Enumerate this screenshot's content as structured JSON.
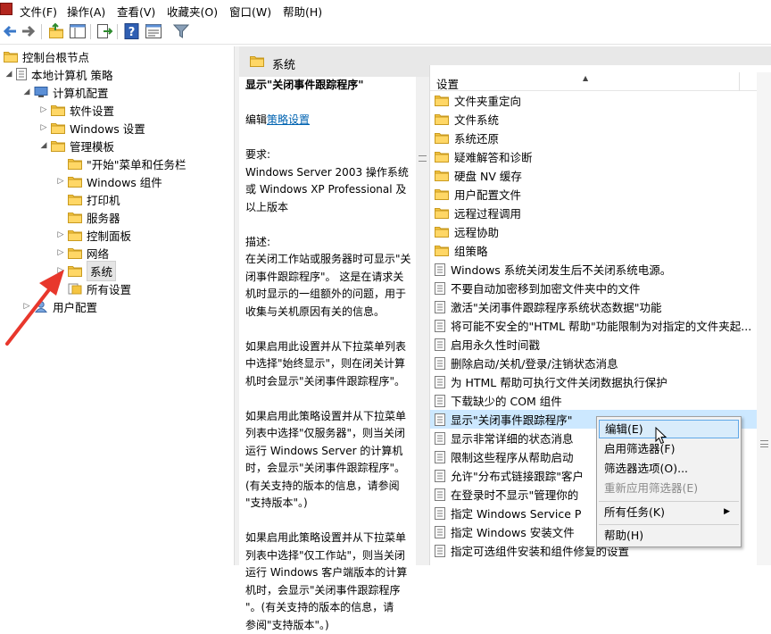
{
  "menubar": {
    "items": [
      "文件(F)",
      "操作(A)",
      "查看(V)",
      "收藏夹(O)",
      "窗口(W)",
      "帮助(H)"
    ]
  },
  "toolbar": {
    "icons": [
      "back-arrow-icon",
      "forward-arrow-icon",
      "up-folder-icon",
      "show-hide-tree-icon",
      "export-list-icon",
      "help-icon",
      "properties-icon",
      "filter-icon"
    ]
  },
  "tree": {
    "items": [
      {
        "label": "控制台根节点",
        "icon": "folder"
      },
      {
        "label": "本地计算机 策略",
        "icon": "policy"
      },
      {
        "label": "计算机配置",
        "icon": "computer"
      },
      {
        "label": "软件设置",
        "icon": "folder"
      },
      {
        "label": "Windows 设置",
        "icon": "folder"
      },
      {
        "label": "管理模板",
        "icon": "folder"
      },
      {
        "label": "\"开始\"菜单和任务栏",
        "icon": "folder"
      },
      {
        "label": "Windows 组件",
        "icon": "folder"
      },
      {
        "label": "打印机",
        "icon": "folder"
      },
      {
        "label": "服务器",
        "icon": "folder"
      },
      {
        "label": "控制面板",
        "icon": "folder"
      },
      {
        "label": "网络",
        "icon": "folder"
      },
      {
        "label": "系统",
        "icon": "folder"
      },
      {
        "label": "所有设置",
        "icon": "all-settings"
      },
      {
        "label": "用户配置",
        "icon": "user"
      }
    ]
  },
  "right_header": {
    "title": "系统"
  },
  "description": {
    "heading": "显示\"关闭事件跟踪程序\"",
    "edit_prefix": "编辑",
    "edit_link": "策略设置",
    "req_label": "要求:",
    "req_lines": [
      "Windows Server 2003 操作系统",
      "或 Windows XP Professional 及",
      "以上版本"
    ],
    "desc_label": "描述:",
    "desc_lines": [
      "在关闭工作站或服务器时可显示\"关",
      "闭事件跟踪程序\"。 这是在请求关",
      "机时显示的一组额外的问题，用于",
      "收集与关机原因有关的信息。"
    ],
    "p1_lines": [
      "如果启用此设置并从下拉菜单列表",
      "中选择\"始终显示\"，则在闭关计算",
      "机时会显示\"关闭事件跟踪程序\"。"
    ],
    "p2_lines": [
      "如果启用此策略设置并从下拉菜单",
      "列表中选择\"仅服务器\"，则当关闭",
      "运行 Windows Server 的计算机",
      "时，会显示\"关闭事件跟踪程序\"。",
      "(有关支持的版本的信息，请参阅",
      "\"支持版本\"。)"
    ],
    "p3_lines": [
      "如果启用此策略设置并从下拉菜单",
      "列表中选择\"仅工作站\"，则当关闭",
      "运行 Windows 客户端版本的计算",
      "机时，会显示\"关闭事件跟踪程序",
      "\"。(有关支持的版本的信息，请",
      "参阅\"支持版本\"。)"
    ]
  },
  "list": {
    "column_header": "设置",
    "rows": [
      {
        "label": "文件夹重定向",
        "icon": "folder"
      },
      {
        "label": "文件系统",
        "icon": "folder"
      },
      {
        "label": "系统还原",
        "icon": "folder"
      },
      {
        "label": "疑难解答和诊断",
        "icon": "folder"
      },
      {
        "label": "硬盘 NV 缓存",
        "icon": "folder"
      },
      {
        "label": "用户配置文件",
        "icon": "folder"
      },
      {
        "label": "远程过程调用",
        "icon": "folder"
      },
      {
        "label": "远程协助",
        "icon": "folder"
      },
      {
        "label": "组策略",
        "icon": "folder"
      },
      {
        "label": "Windows 系统关闭发生后不关闭系统电源。",
        "icon": "policy"
      },
      {
        "label": "不要自动加密移到加密文件夹中的文件",
        "icon": "policy"
      },
      {
        "label": "激活\"关闭事件跟踪程序系统状态数据\"功能",
        "icon": "policy"
      },
      {
        "label": "将可能不安全的\"HTML 帮助\"功能限制为对指定的文件夹起...",
        "icon": "policy"
      },
      {
        "label": "启用永久性时间戳",
        "icon": "policy"
      },
      {
        "label": "删除启动/关机/登录/注销状态消息",
        "icon": "policy"
      },
      {
        "label": "为 HTML 帮助可执行文件关闭数据执行保护",
        "icon": "policy"
      },
      {
        "label": "下载缺少的 COM 组件",
        "icon": "policy"
      },
      {
        "label": "显示\"关闭事件跟踪程序\"",
        "icon": "policy",
        "selected": true
      },
      {
        "label": "显示非常详细的状态消息",
        "icon": "policy"
      },
      {
        "label": "限制这些程序从帮助启动",
        "icon": "policy"
      },
      {
        "label": "允许\"分布式链接跟踪\"客户",
        "icon": "policy"
      },
      {
        "label": "在登录时不显示\"管理你的",
        "icon": "policy"
      },
      {
        "label": "指定 Windows Service P",
        "icon": "policy"
      },
      {
        "label": "指定 Windows 安装文件",
        "icon": "policy"
      },
      {
        "label": "指定可选组件安装和组件修复的设置",
        "icon": "policy"
      }
    ]
  },
  "context_menu": {
    "items": [
      {
        "label": "编辑(E)",
        "state": "highlighted"
      },
      {
        "label": "启用筛选器(F)",
        "state": "normal"
      },
      {
        "label": "筛选器选项(O)...",
        "state": "normal"
      },
      {
        "label": "重新应用筛选器(E)",
        "state": "disabled"
      },
      {
        "label": "所有任务(K)",
        "state": "normal",
        "submenu": true
      },
      {
        "label": "帮助(H)",
        "state": "normal"
      }
    ]
  },
  "colors": {
    "selection": "#cce8ff",
    "folder": "#f5c542",
    "annotation_arrow": "#e8372c",
    "link": "#0063b1"
  }
}
